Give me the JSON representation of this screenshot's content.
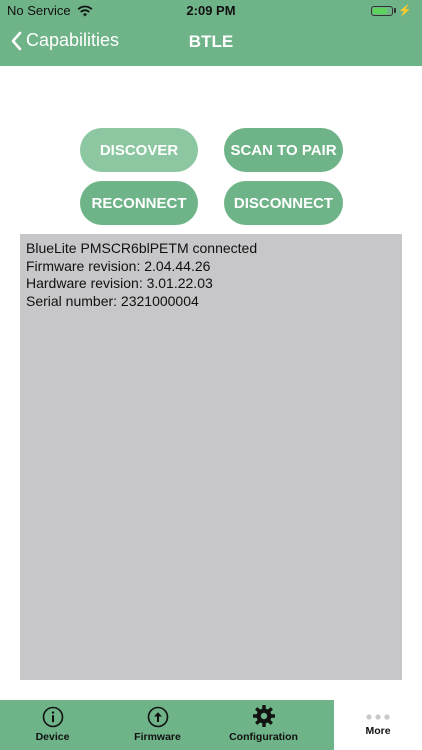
{
  "status_bar": {
    "carrier": "No Service",
    "time": "2:09 PM",
    "battery_level": 0.85
  },
  "nav": {
    "back_label": "Capabilities",
    "title": "BTLE"
  },
  "actions": {
    "discover": "DISCOVER",
    "scan_to_pair": "SCAN TO PAIR",
    "reconnect": "RECONNECT",
    "disconnect": "DISCONNECT"
  },
  "log_lines": [
    "BlueLite PMSCR6blPETM connected",
    "Firmware revision: 2.04.44.26",
    "Hardware revision: 3.01.22.03",
    "Serial number: 2321000004"
  ],
  "tabs": [
    {
      "label": "Device",
      "icon": "info-icon"
    },
    {
      "label": "Firmware",
      "icon": "upload-icon"
    },
    {
      "label": "Configuration",
      "icon": "gear-icon"
    },
    {
      "label": "More",
      "icon": "more-dots-icon",
      "selected": true
    }
  ],
  "colors": {
    "accent": "#6fb388",
    "accent_light": "#8cc7a1",
    "log_background": "#c7c7c9"
  }
}
